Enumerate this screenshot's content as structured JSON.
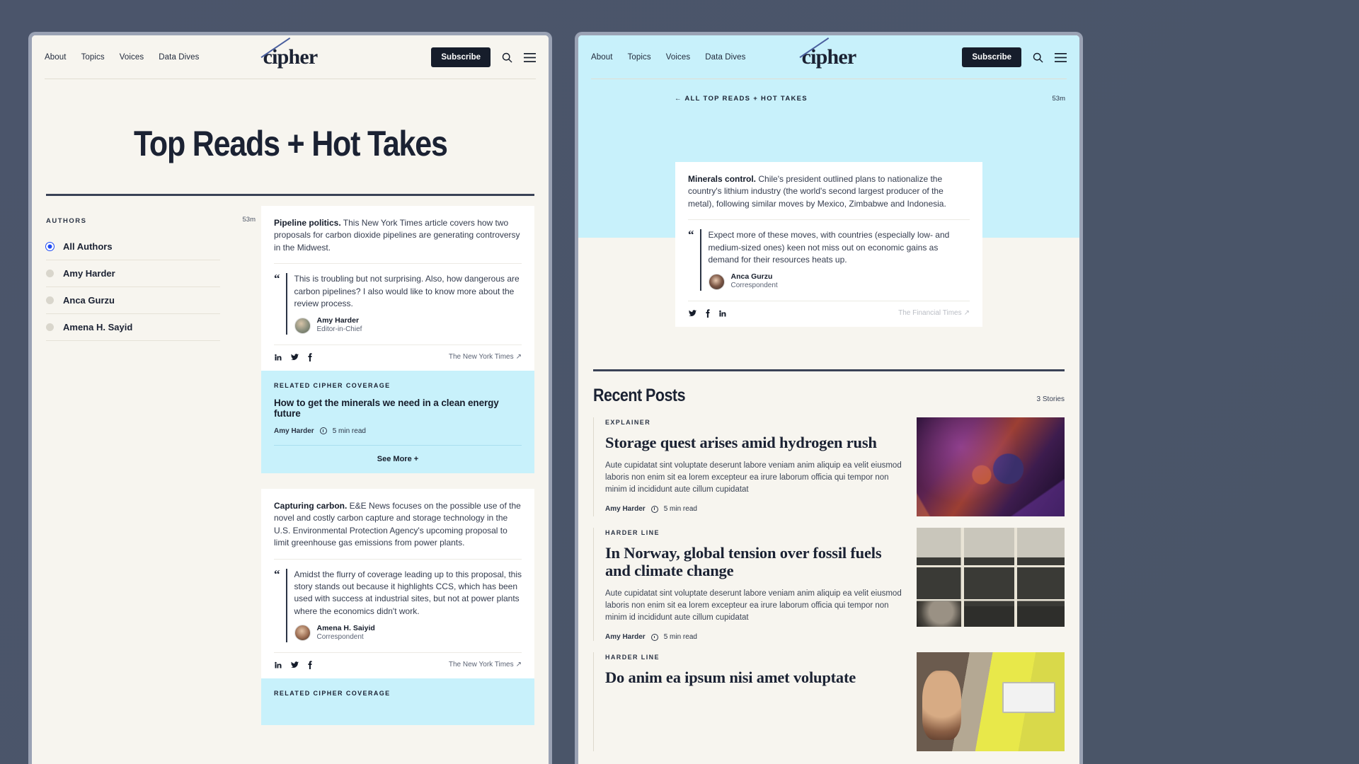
{
  "nav": {
    "links": [
      "About",
      "Topics",
      "Voices",
      "Data Dives"
    ],
    "logo": "cipher",
    "subscribe": "Subscribe",
    "search_icon": "search-icon",
    "menu_icon": "hamburger-menu-icon"
  },
  "left": {
    "page_title": "Top Reads + Hot Takes",
    "authors_label": "AUTHORS",
    "authors": [
      {
        "name": "All Authors",
        "selected": true
      },
      {
        "name": "Amy Harder",
        "selected": false
      },
      {
        "name": "Anca Gurzu",
        "selected": false
      },
      {
        "name": "Amena H. Sayid",
        "selected": false
      }
    ],
    "timestamp": "53m",
    "cards": [
      {
        "lede_bold": "Pipeline politics.",
        "lede_rest": " This New York Times article covers how two proposals for carbon dioxide pipelines are generating controversy in the Midwest.",
        "quote": "This is troubling but not surprising. Also, how dangerous are carbon pipelines? I also would like to know more about the review process.",
        "author_name": "Amy Harder",
        "author_role": "Editor-in-Chief",
        "socials": [
          "linkedin-icon",
          "twitter-icon",
          "facebook-icon"
        ],
        "source": "The New York Times"
      },
      {
        "lede_bold": "Capturing carbon.",
        "lede_rest": " E&E News focuses on the possible use of the novel and costly carbon capture and storage technology in the U.S. Environmental Protection Agency's upcoming proposal to limit greenhouse gas emissions from power plants.",
        "quote": "Amidst the flurry of coverage leading up to this proposal, this story stands out because it highlights CCS, which has been used with success at industrial sites, but not at power plants where the economics didn't work.",
        "author_name": "Amena H. Saiyid",
        "author_role": "Correspondent",
        "socials": [
          "linkedin-icon",
          "twitter-icon",
          "facebook-icon"
        ],
        "source": "The New York Times"
      }
    ],
    "related": [
      {
        "label": "RELATED CIPHER COVERAGE",
        "title": "How to get the minerals we need in a clean energy future",
        "author": "Amy Harder",
        "read_time": "5 min read",
        "see_more": "See More +"
      },
      {
        "label": "RELATED CIPHER COVERAGE"
      }
    ]
  },
  "right": {
    "back_link": "← ALL TOP READS + HOT TAKES",
    "timestamp": "53m",
    "card": {
      "lede_bold": "Minerals control.",
      "lede_rest": " Chile's president outlined plans to nationalize the country's lithium industry (the world's second largest producer of the metal), following similar moves by Mexico, Zimbabwe and Indonesia.",
      "quote": "Expect more of these moves, with countries (especially low- and medium-sized ones) keen not miss out on economic gains as demand for their resources heats up.",
      "author_name": "Anca Gurzu",
      "author_role": "Correspondent",
      "socials": [
        "twitter-icon",
        "facebook-icon",
        "linkedin-icon"
      ],
      "source": "The Financial Times"
    },
    "recent": {
      "title": "Recent Posts",
      "count": "3 Stories",
      "posts": [
        {
          "kicker": "EXPLAINER",
          "title": "Storage quest arises amid hydrogen rush",
          "dek": "Aute cupidatat sint voluptate deserunt labore veniam anim aliquip ea velit eiusmod laboris non enim sit ea lorem excepteur ea irure laborum officia qui tempor non minim id incididunt aute cillum cupidatat",
          "author": "Amy Harder",
          "read_time": "5 min read",
          "thumb": "abstract-3d-render-thumbnail"
        },
        {
          "kicker": "HARDER LINE",
          "title": "In Norway, global tension over fossil fuels and climate change",
          "dek": "Aute cupidatat sint voluptate deserunt labore veniam anim aliquip ea velit eiusmod laboris non enim sit ea lorem excepteur ea irure laborum officia qui tempor non minim id incididunt aute cillum cupidatat",
          "author": "Amy Harder",
          "read_time": "5 min read",
          "thumb": "black-white-collage-thumbnail"
        },
        {
          "kicker": "HARDER LINE",
          "title": "Do anim ea ipsum nisi amet voluptate",
          "dek": "",
          "author": "",
          "read_time": "",
          "thumb": "portrait-yellow-thumbnail"
        }
      ]
    }
  }
}
